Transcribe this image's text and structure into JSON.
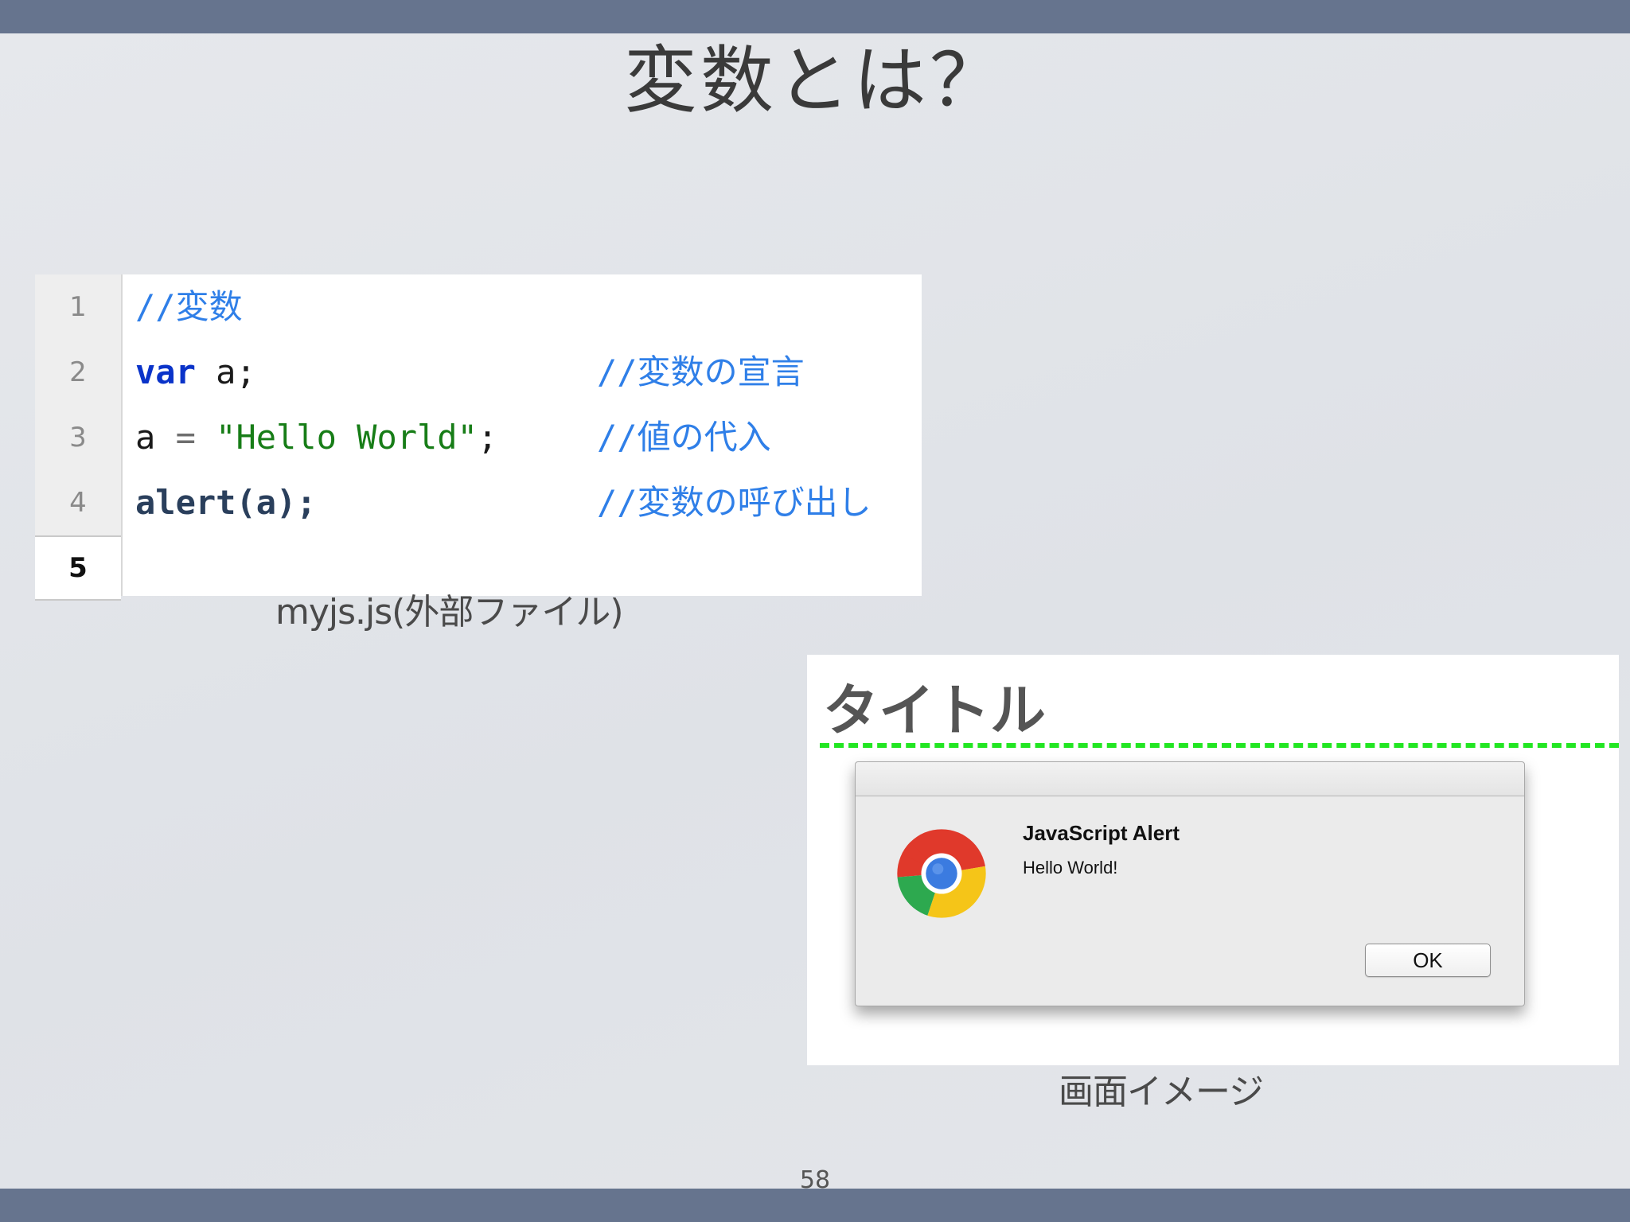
{
  "slide": {
    "title": "変数とは？",
    "page_number": "58"
  },
  "editor": {
    "caption": "myjs.js(外部ファイル)",
    "active_line": 5,
    "line_numbers": [
      "1",
      "2",
      "3",
      "4",
      "5"
    ],
    "lines": [
      {
        "code": "//変数",
        "comment": ""
      },
      {
        "keyword": "var",
        "rest": " a;",
        "comment": "//変数の宣言"
      },
      {
        "ident": "a",
        "op": " = ",
        "string": "\"Hello World\"",
        "rest": ";",
        "comment": "//値の代入"
      },
      {
        "call": "alert",
        "rest": "(a);",
        "comment": "//変数の呼び出し"
      },
      {
        "code": "",
        "comment": ""
      }
    ]
  },
  "screen": {
    "caption": "画面イメージ",
    "page_heading": "タイトル",
    "dialog": {
      "title": "JavaScript Alert",
      "message": "Hello World!",
      "ok_label": "OK",
      "icon": "chrome-logo-icon"
    }
  },
  "colors": {
    "header_bar": "#66748e",
    "comment": "#2f7fe8",
    "keyword": "#0a33c9",
    "string": "#177d17",
    "dashed_rule": "#22e622"
  }
}
